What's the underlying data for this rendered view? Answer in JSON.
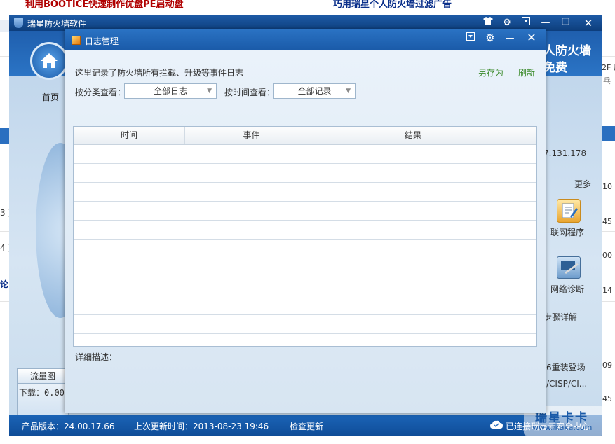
{
  "background_page": {
    "top_link_left": "利用BOOTICE快速制作优盘PE启动盘",
    "top_link_right": "巧用瑞星个人防火墙过滤广告",
    "ip_fragment": "7.131.178",
    "more_label": "更多",
    "num_10": "10",
    "num_45a": "45",
    "num_00": "00",
    "num_14": "14",
    "num_09": "09",
    "num_45b": "45",
    "right_top": "2F 风",
    "right_top2": "乓",
    "left_frag1": "3 ]",
    "left_frag2": "4 ]",
    "left_frag3": "论",
    "steps_label": "步骤详解",
    "reinstall": "6重装登场",
    "cisp": "/CISP/CI..."
  },
  "main_window": {
    "title": "瑞星防火墙软件",
    "ad_line1": "人防火墙",
    "ad_line2": "免费",
    "home_label": "首页",
    "network_program": "联网程序",
    "network_diag": "网络诊断",
    "traffic_tab": "流量图",
    "download_label": "下载：0.00",
    "footer": {
      "version": "产品版本：24.00.17.66",
      "last_update": "上次更新时间：2013-08-23 19:46",
      "check_update": "检查更新",
      "connected": "已连接瑞星云安全中心"
    },
    "watermark": {
      "line1": "瑞星卡卡",
      "line2": "www.ikaka.com"
    }
  },
  "log_dialog": {
    "title": "日志管理",
    "description": "这里记录了防火墙所有拦截、升级等事件日志",
    "save_as": "另存为",
    "refresh": "刷新",
    "category_label": "按分类查看：",
    "category_value": "全部日志",
    "time_label": "按时间查看：",
    "time_value": "全部记录",
    "columns": [
      "时间",
      "事件",
      "结果"
    ],
    "detail_label": "详细描述："
  },
  "colors": {
    "title_blue": "#1a5aa8",
    "link_green": "#3a8a2a",
    "footer_blue": "#1b64b7"
  }
}
